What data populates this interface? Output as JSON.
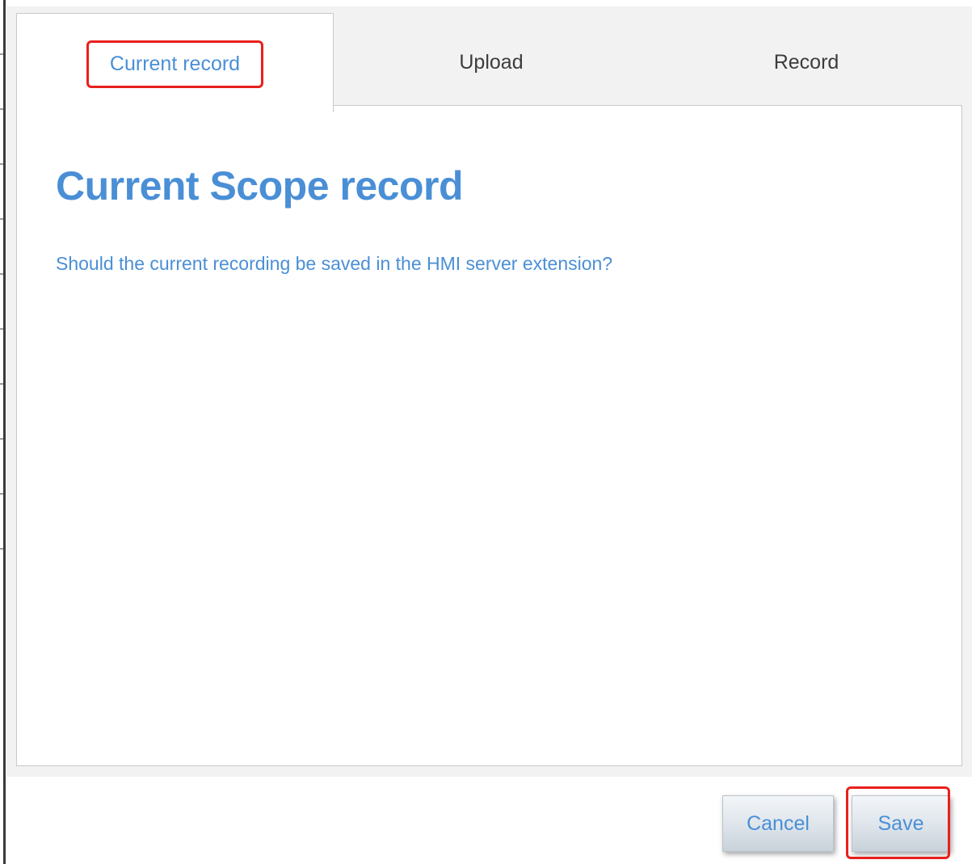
{
  "tabs": {
    "current_record": "Current record",
    "upload": "Upload",
    "record": "Record"
  },
  "content": {
    "title": "Current Scope record",
    "question": "Should the current recording be saved in the HMI server extension?"
  },
  "footer": {
    "cancel_label": "Cancel",
    "save_label": "Save"
  },
  "colors": {
    "accent": "#4a8fd6",
    "highlight": "#e8201c",
    "tab_bar_bg": "#f2f2f2"
  }
}
